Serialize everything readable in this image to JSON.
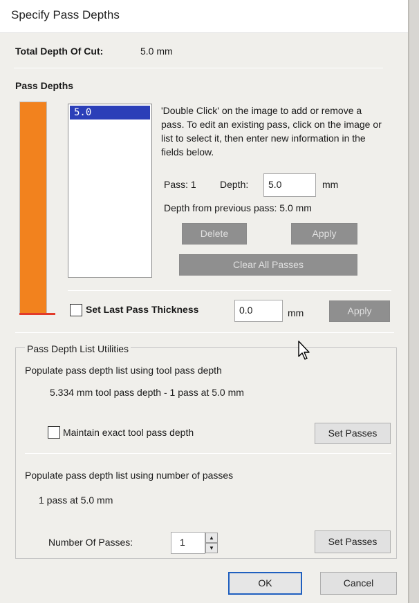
{
  "window": {
    "title": "Specify Pass Depths"
  },
  "total_depth": {
    "label": "Total Depth Of Cut:",
    "value": "5.0 mm"
  },
  "pass_depths": {
    "section_label": "Pass Depths",
    "list_items": [
      "5.0"
    ],
    "instructions": "'Double Click' on the image to add or remove a pass. To edit an existing pass, click on the image or list to select it, then enter new information in the fields below.",
    "pass_label": "Pass: 1",
    "depth_label": "Depth:",
    "depth_value": "5.0",
    "depth_unit": "mm",
    "depth_from_previous": "Depth from previous pass:  5.0 mm",
    "delete_button": "Delete",
    "apply_button": "Apply",
    "clear_all_button": "Clear All Passes",
    "bar_color": "#f2821e"
  },
  "last_pass": {
    "label": "Set Last Pass Thickness",
    "value": "0.0",
    "unit": "mm",
    "apply_button": "Apply",
    "checked": false
  },
  "utilities": {
    "group_title": "Pass Depth List Utilities",
    "tool_heading": "Populate pass depth list using tool pass depth",
    "tool_info": "5.334 mm tool pass depth - 1 pass at 5.0 mm",
    "maintain_label": "Maintain exact tool pass depth",
    "maintain_checked": false,
    "set_passes_button_1": "Set Passes",
    "number_heading": "Populate pass depth list using number of passes",
    "number_info": "1 pass at 5.0 mm",
    "number_label": "Number Of Passes:",
    "number_value": "1",
    "set_passes_button_2": "Set Passes"
  },
  "footer": {
    "ok_button": "OK",
    "cancel_button": "Cancel"
  }
}
